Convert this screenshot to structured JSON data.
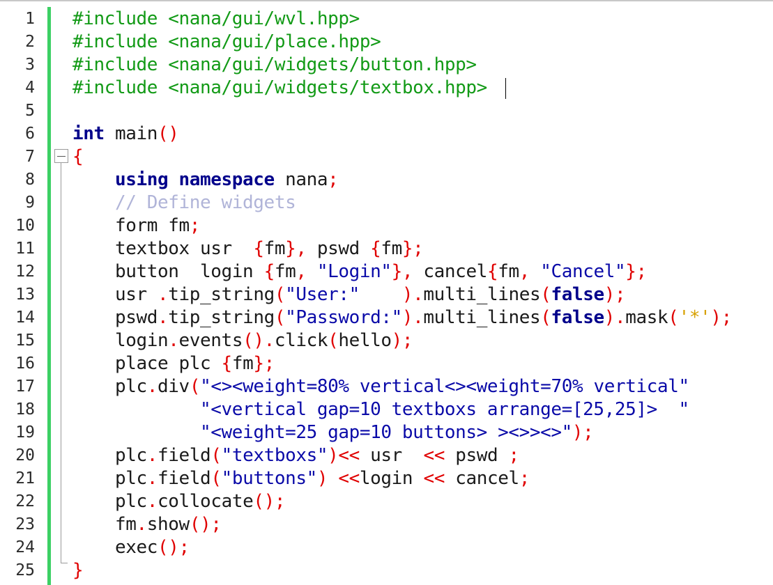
{
  "editor": {
    "line_numbers": [
      "1",
      "2",
      "3",
      "4",
      "5",
      "6",
      "7",
      "8",
      "9",
      "10",
      "11",
      "12",
      "13",
      "14",
      "15",
      "16",
      "17",
      "18",
      "19",
      "20",
      "21",
      "22",
      "23",
      "24",
      "25"
    ],
    "lines": [
      [
        {
          "t": "#include <nana/gui/wvl.hpp>",
          "c": "pp"
        }
      ],
      [
        {
          "t": "#include <nana/gui/place.hpp>",
          "c": "pp"
        }
      ],
      [
        {
          "t": "#include <nana/gui/widgets/button.hpp>",
          "c": "pp"
        }
      ],
      [
        {
          "t": "#include <nana/gui/widgets/textbox.hpp>",
          "c": "pp"
        }
      ],
      [],
      [
        {
          "t": "int",
          "c": "kw"
        },
        {
          "t": " main",
          "c": "tx"
        },
        {
          "t": "()",
          "c": "op"
        }
      ],
      [
        {
          "t": "{",
          "c": "op"
        }
      ],
      [
        {
          "t": "    ",
          "c": "tx"
        },
        {
          "t": "using namespace",
          "c": "kw"
        },
        {
          "t": " nana",
          "c": "tx"
        },
        {
          "t": ";",
          "c": "op"
        }
      ],
      [
        {
          "t": "    // Define widgets",
          "c": "cm"
        }
      ],
      [
        {
          "t": "    form fm",
          "c": "tx"
        },
        {
          "t": ";",
          "c": "op"
        }
      ],
      [
        {
          "t": "    textbox usr  ",
          "c": "tx"
        },
        {
          "t": "{",
          "c": "op"
        },
        {
          "t": "fm",
          "c": "tx"
        },
        {
          "t": "},",
          "c": "op"
        },
        {
          "t": " pswd ",
          "c": "tx"
        },
        {
          "t": "{",
          "c": "op"
        },
        {
          "t": "fm",
          "c": "tx"
        },
        {
          "t": "};",
          "c": "op"
        }
      ],
      [
        {
          "t": "    button  login ",
          "c": "tx"
        },
        {
          "t": "{",
          "c": "op"
        },
        {
          "t": "fm",
          "c": "tx"
        },
        {
          "t": ",",
          "c": "op"
        },
        {
          "t": " ",
          "c": "tx"
        },
        {
          "t": "\"Login\"",
          "c": "st"
        },
        {
          "t": "},",
          "c": "op"
        },
        {
          "t": " cancel",
          "c": "tx"
        },
        {
          "t": "{",
          "c": "op"
        },
        {
          "t": "fm",
          "c": "tx"
        },
        {
          "t": ",",
          "c": "op"
        },
        {
          "t": " ",
          "c": "tx"
        },
        {
          "t": "\"Cancel\"",
          "c": "st"
        },
        {
          "t": "};",
          "c": "op"
        }
      ],
      [
        {
          "t": "    usr ",
          "c": "tx"
        },
        {
          "t": ".",
          "c": "op"
        },
        {
          "t": "tip_string",
          "c": "tx"
        },
        {
          "t": "(",
          "c": "op"
        },
        {
          "t": "\"User:\"",
          "c": "st"
        },
        {
          "t": "    ",
          "c": "tx"
        },
        {
          "t": ").",
          "c": "op"
        },
        {
          "t": "multi_lines",
          "c": "tx"
        },
        {
          "t": "(",
          "c": "op"
        },
        {
          "t": "false",
          "c": "kw"
        },
        {
          "t": ");",
          "c": "op"
        }
      ],
      [
        {
          "t": "    pswd",
          "c": "tx"
        },
        {
          "t": ".",
          "c": "op"
        },
        {
          "t": "tip_string",
          "c": "tx"
        },
        {
          "t": "(",
          "c": "op"
        },
        {
          "t": "\"Password:\"",
          "c": "st"
        },
        {
          "t": ").",
          "c": "op"
        },
        {
          "t": "multi_lines",
          "c": "tx"
        },
        {
          "t": "(",
          "c": "op"
        },
        {
          "t": "false",
          "c": "kw"
        },
        {
          "t": ").",
          "c": "op"
        },
        {
          "t": "mask",
          "c": "tx"
        },
        {
          "t": "(",
          "c": "op"
        },
        {
          "t": "'*'",
          "c": "ch"
        },
        {
          "t": ");",
          "c": "op"
        }
      ],
      [
        {
          "t": "    login",
          "c": "tx"
        },
        {
          "t": ".",
          "c": "op"
        },
        {
          "t": "events",
          "c": "tx"
        },
        {
          "t": "().",
          "c": "op"
        },
        {
          "t": "click",
          "c": "tx"
        },
        {
          "t": "(",
          "c": "op"
        },
        {
          "t": "hello",
          "c": "tx"
        },
        {
          "t": ");",
          "c": "op"
        }
      ],
      [
        {
          "t": "    place plc ",
          "c": "tx"
        },
        {
          "t": "{",
          "c": "op"
        },
        {
          "t": "fm",
          "c": "tx"
        },
        {
          "t": "};",
          "c": "op"
        }
      ],
      [
        {
          "t": "    plc",
          "c": "tx"
        },
        {
          "t": ".",
          "c": "op"
        },
        {
          "t": "div",
          "c": "tx"
        },
        {
          "t": "(",
          "c": "op"
        },
        {
          "t": "\"<><weight=80% vertical<><weight=70% vertical\"",
          "c": "st"
        }
      ],
      [
        {
          "t": "            ",
          "c": "tx"
        },
        {
          "t": "\"<vertical gap=10 textboxs arrange=[25,25]>  \"",
          "c": "st"
        }
      ],
      [
        {
          "t": "            ",
          "c": "tx"
        },
        {
          "t": "\"<weight=25 gap=10 buttons> ><>><>\"",
          "c": "st"
        },
        {
          "t": ");",
          "c": "op"
        }
      ],
      [
        {
          "t": "    plc",
          "c": "tx"
        },
        {
          "t": ".",
          "c": "op"
        },
        {
          "t": "field",
          "c": "tx"
        },
        {
          "t": "(",
          "c": "op"
        },
        {
          "t": "\"textboxs\"",
          "c": "st"
        },
        {
          "t": ")<<",
          "c": "op"
        },
        {
          "t": " usr  ",
          "c": "tx"
        },
        {
          "t": "<<",
          "c": "op"
        },
        {
          "t": " pswd ",
          "c": "tx"
        },
        {
          "t": ";",
          "c": "op"
        }
      ],
      [
        {
          "t": "    plc",
          "c": "tx"
        },
        {
          "t": ".",
          "c": "op"
        },
        {
          "t": "field",
          "c": "tx"
        },
        {
          "t": "(",
          "c": "op"
        },
        {
          "t": "\"buttons\"",
          "c": "st"
        },
        {
          "t": ")",
          "c": "op"
        },
        {
          "t": " ",
          "c": "tx"
        },
        {
          "t": "<<",
          "c": "op"
        },
        {
          "t": "login ",
          "c": "tx"
        },
        {
          "t": "<<",
          "c": "op"
        },
        {
          "t": " cancel",
          "c": "tx"
        },
        {
          "t": ";",
          "c": "op"
        }
      ],
      [
        {
          "t": "    plc",
          "c": "tx"
        },
        {
          "t": ".",
          "c": "op"
        },
        {
          "t": "collocate",
          "c": "tx"
        },
        {
          "t": "();",
          "c": "op"
        }
      ],
      [
        {
          "t": "    fm",
          "c": "tx"
        },
        {
          "t": ".",
          "c": "op"
        },
        {
          "t": "show",
          "c": "tx"
        },
        {
          "t": "();",
          "c": "op"
        }
      ],
      [
        {
          "t": "    exec",
          "c": "tx"
        },
        {
          "t": "();",
          "c": "op"
        }
      ],
      [
        {
          "t": "}",
          "c": "op"
        }
      ]
    ]
  },
  "colors": {
    "preprocessor": "#129a16",
    "keyword": "#00008b",
    "operator": "#e00000",
    "string": "#0a0aa8",
    "comment": "#b0b4d8",
    "char_literal": "#d7a000",
    "change_bar": "#3cd064"
  }
}
